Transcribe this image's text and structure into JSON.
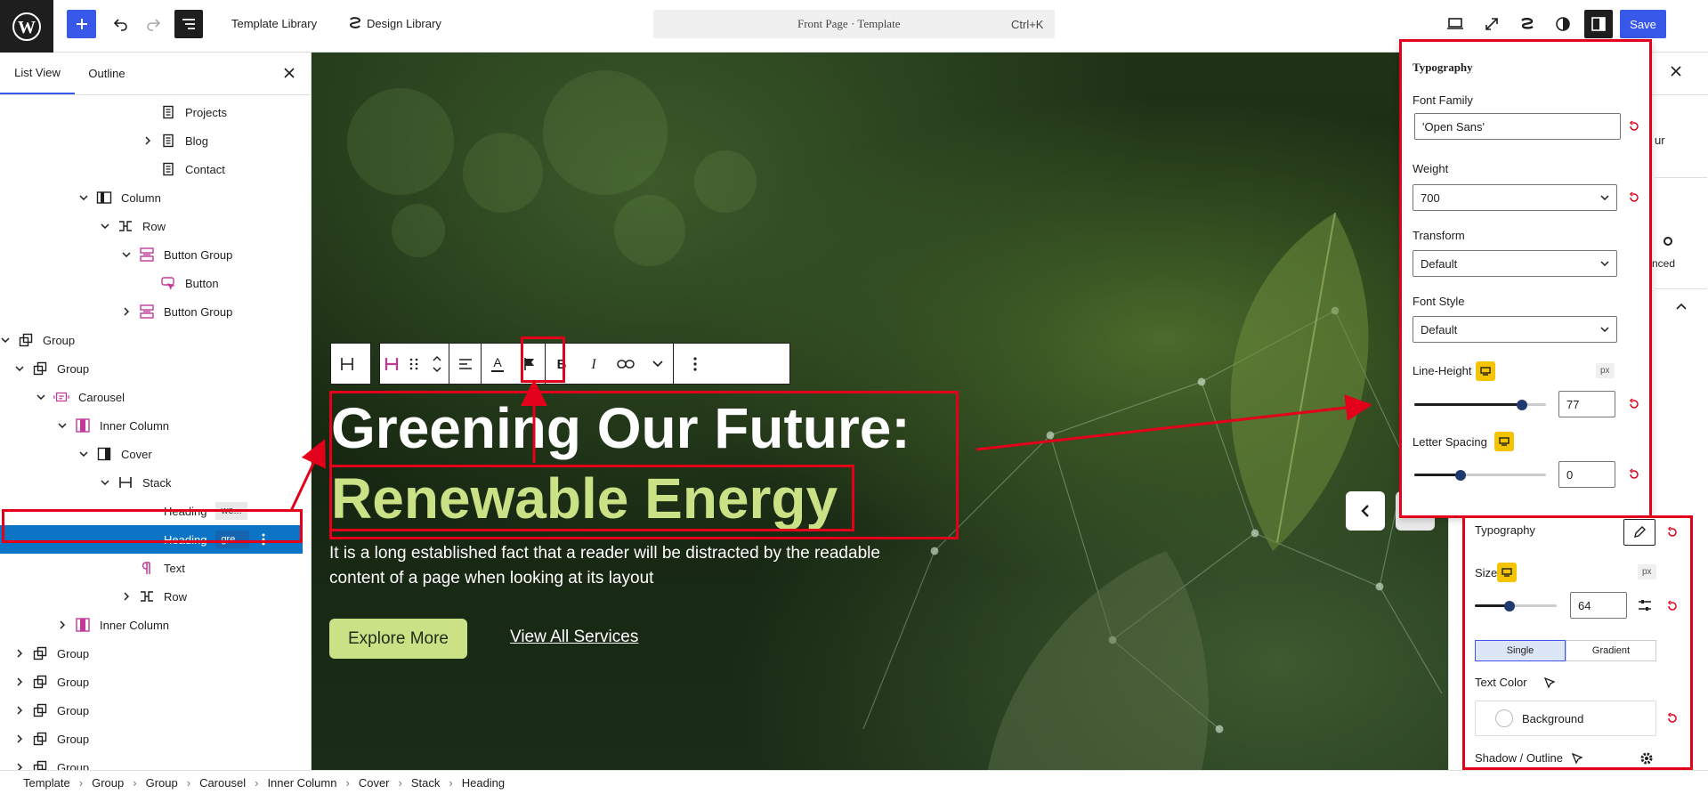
{
  "topbar": {
    "template_library": "Template Library",
    "design_library": "Design Library",
    "command_title": "Front Page · Template",
    "command_shortcut": "Ctrl+K",
    "save": "Save"
  },
  "left_panel": {
    "tabs": [
      "List View",
      "Outline"
    ],
    "tree": [
      {
        "label": "Projects",
        "tag": ""
      },
      {
        "label": "Blog",
        "tag": ""
      },
      {
        "label": "Contact",
        "tag": ""
      },
      {
        "label": "Column",
        "tag": ""
      },
      {
        "label": "Row",
        "tag": ""
      },
      {
        "label": "Button Group",
        "tag": ""
      },
      {
        "label": "Button",
        "tag": ""
      },
      {
        "label": "Button Group",
        "tag": ""
      },
      {
        "label": "Group",
        "tag": ""
      },
      {
        "label": "Group",
        "tag": ""
      },
      {
        "label": "Carousel",
        "tag": ""
      },
      {
        "label": "Inner Column",
        "tag": ""
      },
      {
        "label": "Cover",
        "tag": ""
      },
      {
        "label": "Stack",
        "tag": ""
      },
      {
        "label": "Heading",
        "tag": "we..."
      },
      {
        "label": "Heading",
        "tag": "gre..."
      },
      {
        "label": "Text",
        "tag": ""
      },
      {
        "label": "Row",
        "tag": ""
      },
      {
        "label": "Inner Column",
        "tag": ""
      },
      {
        "label": "Group",
        "tag": ""
      },
      {
        "label": "Group",
        "tag": ""
      },
      {
        "label": "Group",
        "tag": ""
      },
      {
        "label": "Group",
        "tag": ""
      },
      {
        "label": "Group",
        "tag": ""
      }
    ]
  },
  "breadcrumbs": [
    "Template",
    "Group",
    "Group",
    "Carousel",
    "Inner Column",
    "Cover",
    "Stack",
    "Heading"
  ],
  "canvas": {
    "heading_line1": "Greening Our Future:",
    "heading_line2": "Renewable Energy",
    "paragraph": "It is a long established fact that a reader will be distracted by the readable content of a page when looking at its layout",
    "explore_button": "Explore More",
    "view_all_link": "View All Services"
  },
  "typography_popover": {
    "title": "Typography",
    "font_family_label": "Font Family",
    "font_family_value": "'Open Sans'",
    "weight_label": "Weight",
    "weight_value": "700",
    "transform_label": "Transform",
    "transform_value": "Default",
    "font_style_label": "Font Style",
    "font_style_value": "Default",
    "line_height_label": "Line-Height",
    "line_height_value": "77",
    "line_height_unit": "px",
    "line_height_level": 0.82,
    "letter_spacing_label": "Letter Spacing",
    "letter_spacing_value": "0",
    "letter_spacing_level": 0.35
  },
  "lower_panel": {
    "typography_label": "Typography",
    "size_label": "Size",
    "size_unit": "px",
    "size_value": "64",
    "size_level": 0.42,
    "single_tab": "Single",
    "gradient_tab": "Gradient",
    "text_color_label": "Text Color",
    "background_label": "Background",
    "shadow_label": "Shadow / Outline"
  },
  "right_panel_partial": {
    "text_a": "ur",
    "text_b": "nced"
  },
  "colors": {
    "accent": "#3858e9",
    "annotation_red": "#e2001a",
    "selected_row": "#0b74c4",
    "heading_green": "#cbe186",
    "responsive_yellow": "#f5c400"
  }
}
